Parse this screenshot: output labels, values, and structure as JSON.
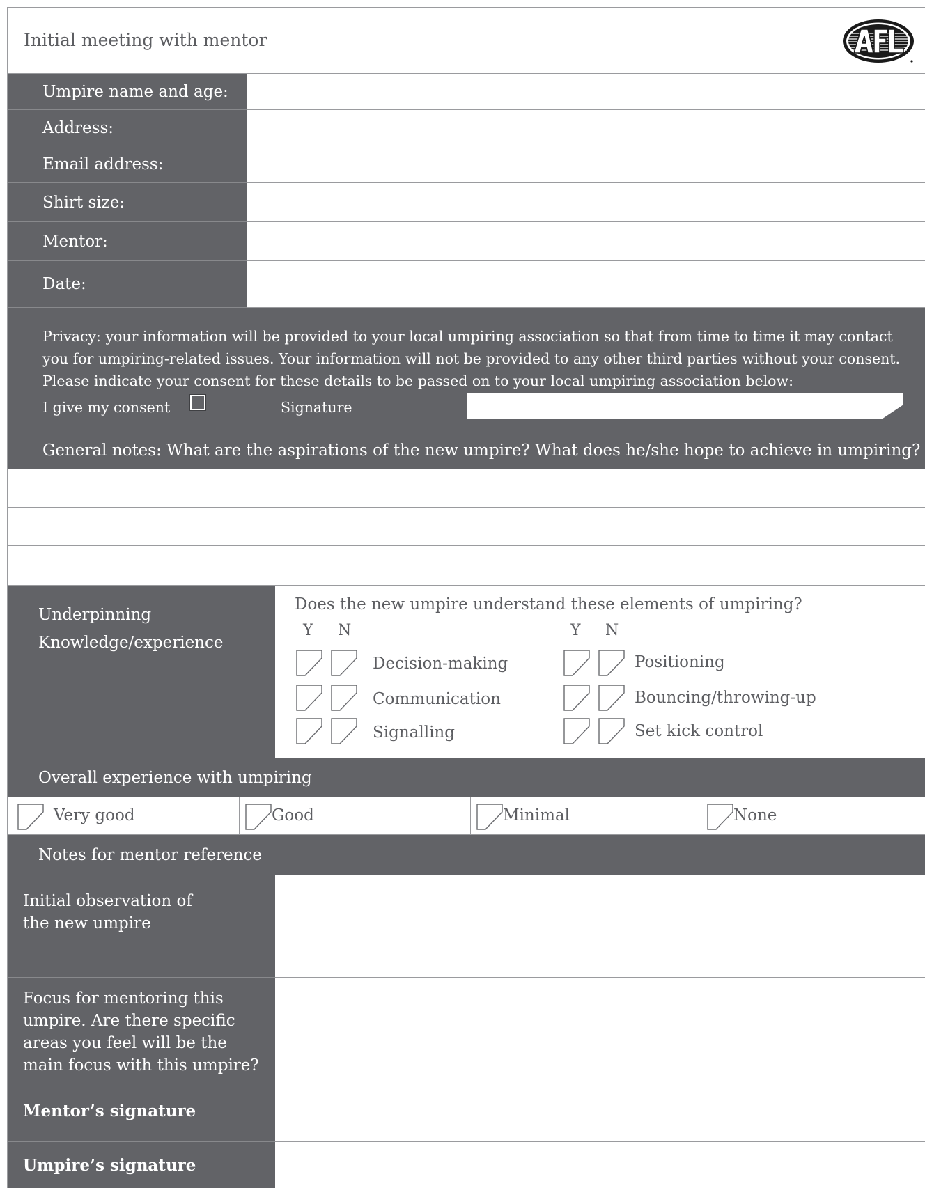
{
  "header": {
    "title": "Initial meeting with mentor",
    "logo_text": "AFL"
  },
  "details": {
    "fields": [
      {
        "label": "Umpire name and age:",
        "value": ""
      },
      {
        "label": "Address:",
        "value": ""
      },
      {
        "label": "Email address:",
        "value": ""
      },
      {
        "label": "Shirt size:",
        "value": ""
      },
      {
        "label": "Mentor:",
        "value": ""
      },
      {
        "label": "Date:",
        "value": ""
      }
    ]
  },
  "privacy": {
    "text": "Privacy: your information will be provided to your local umpiring association so that from time to time it may contact you for umpiring-related issues. Your information will not be provided to any other third parties without your consent. Please indicate your consent for these details to be passed on to your local umpiring association below:",
    "consent_label": "I give my consent",
    "signature_label": "Signature",
    "signature_value": ""
  },
  "general_notes": {
    "heading": "General notes: What are the aspirations of the new umpire? What does he/she hope to achieve in umpiring?"
  },
  "underpinning": {
    "label_line1": "Underpinning",
    "label_line2": "Knowledge/experience",
    "question": "Does the new umpire understand these elements of umpiring?",
    "yes": "Y",
    "no": "N",
    "left_items": [
      "Decision-making",
      "Communication",
      "Signalling"
    ],
    "right_items": [
      "Positioning",
      "Bouncing/throwing-up",
      "Set kick control"
    ]
  },
  "overall": {
    "heading": "Overall experience with umpiring",
    "options": [
      "Very good",
      "Good",
      "Minimal",
      "None"
    ]
  },
  "mentor_notes": {
    "heading": "Notes for mentor reference",
    "initial_observation": "Initial observation of the new umpire",
    "focus": "Focus for mentoring this umpire. Are there specific areas you feel will be the main focus with this umpire?",
    "mentor_signature": "Mentor’s signature",
    "umpire_signature": "Umpire’s signature"
  },
  "colors": {
    "dark_panel": "#626367",
    "text_grey": "#5d5e62",
    "rule": "#9a9b9e"
  }
}
